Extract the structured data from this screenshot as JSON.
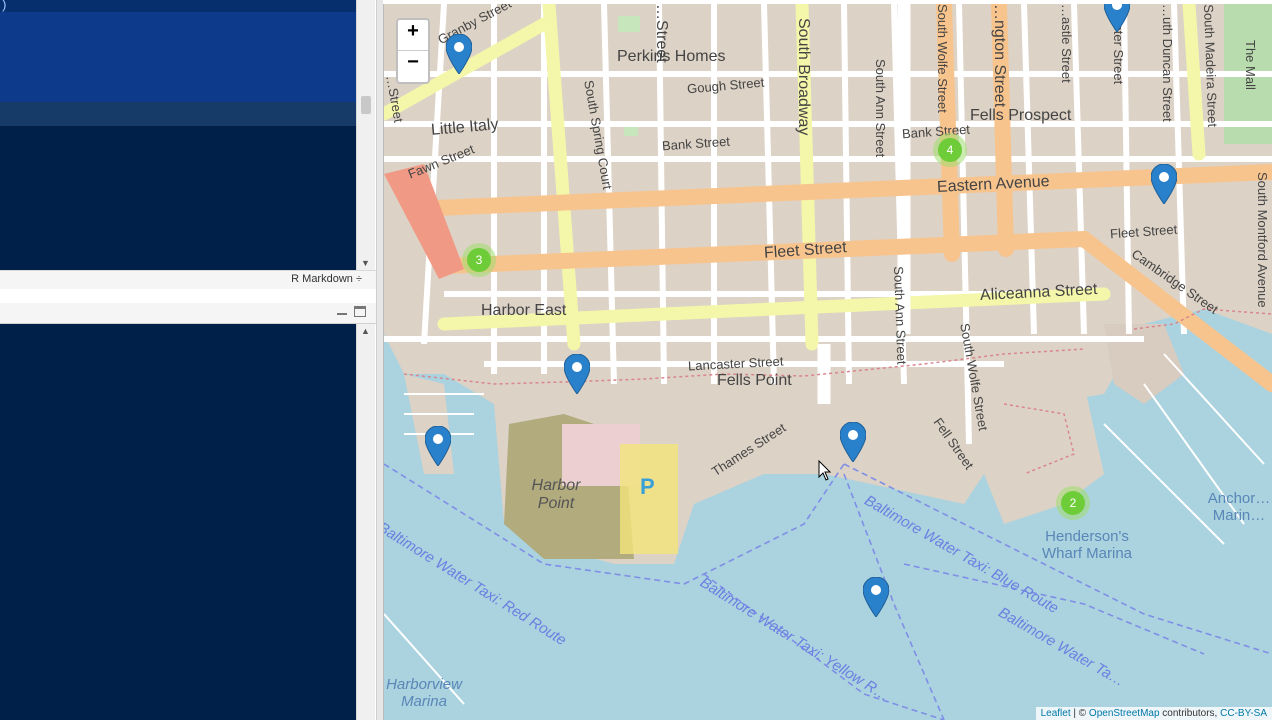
{
  "editor": {
    "caret_glyph": ")",
    "doc_mode": "R Markdown ÷"
  },
  "map": {
    "zoom_in": "+",
    "zoom_out": "−",
    "labels": {
      "perkins_homes": "Perkins Homes",
      "gough_street": "Gough Street",
      "little_italy": "Little Italy",
      "fawn_street": "Fawn Street",
      "bank_street": "Bank Street",
      "bank_street_2": "Bank Street",
      "fells_prospect": "Fells Prospect",
      "eastern_avenue": "Eastern Avenue",
      "fleet_street": "Fleet Street",
      "fleet_street_2": "Fleet Street",
      "cambridge_street": "Cambridge Street",
      "harbor_east": "Harbor East",
      "aliceanna_street": "Aliceanna Street",
      "lancaster_street": "Lancaster Street",
      "fells_point": "Fells Point",
      "thames_street": "Thames Street",
      "fell_street": "Fell Street",
      "harbor_point": "Harbor Point",
      "hendersons_wharf": "Henderson's Wharf Marina",
      "anchorage_marina": "Anchor… Marin…",
      "harborview_marina": "Harborview Marina",
      "water_taxi_red": "Baltimore Water Taxi: Red Route",
      "water_taxi_yellow": "Baltimore Water Taxi: Yellow R…",
      "water_taxi_blue": "Baltimore Water Taxi: Blue Route",
      "water_taxi_blue_2": "Baltimore Water Ta…",
      "granby_street": "Granby Street",
      "south_spring_court": "South Spring Court",
      "south_broadway": "South Broadway",
      "south_ann_street": "South Ann Street",
      "south_ann_street_2": "South Ann Street",
      "south_wolfe_street": "South Wolfe Street",
      "south_wolfe_street_2": "South Wolfe Street",
      "washington_street": "…ngton Street",
      "castle_street": "…astle Street",
      "chester_street": "…ester Street",
      "duncan_street": "…uth Duncan Street",
      "madeira_street": "South Madeira Street",
      "the_mall": "The Mall",
      "montford_avenue": "South Montford Avenue",
      "street_top": "…Street",
      "street_left": "…Street"
    },
    "clusters": [
      "4",
      "3",
      "2"
    ],
    "parking": "P",
    "attribution": {
      "leaflet": "Leaflet",
      "separator": " | © ",
      "osm": "OpenStreetMap",
      "contributors": " contributors, ",
      "license": "CC-BY-SA"
    },
    "colors": {
      "water": "#aad3df",
      "land": "#dcd2c6",
      "primary_road": "#f8c48e",
      "secondary_road": "#f4f7a9",
      "marker": "#2a81cb",
      "cluster": "#6ecc39"
    }
  }
}
